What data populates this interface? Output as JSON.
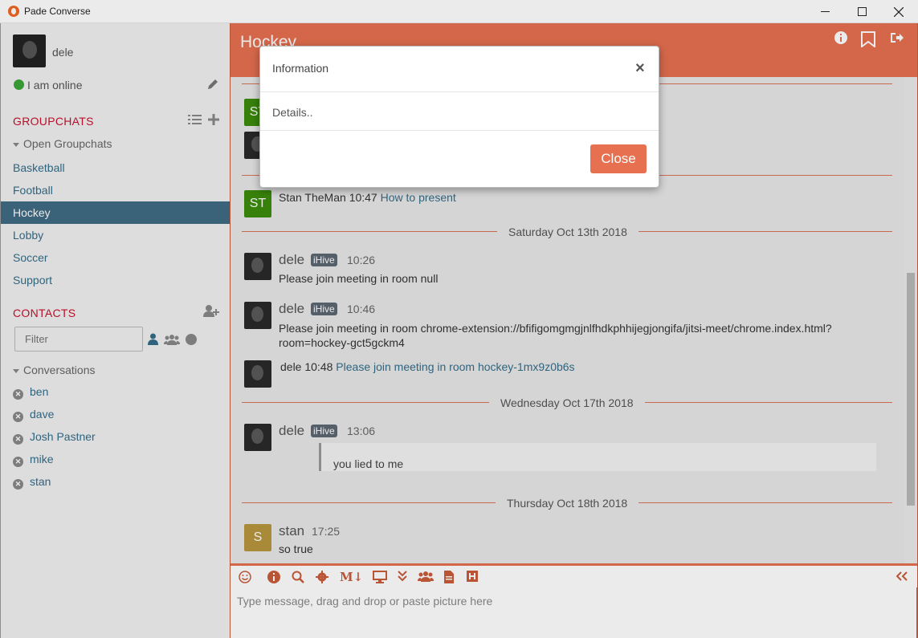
{
  "window": {
    "title": "Pade Converse"
  },
  "profile": {
    "name": "dele",
    "status": "I am online"
  },
  "groupchats": {
    "title": "GROUPCHATS",
    "tree_label": "Open Groupchats",
    "rooms": [
      "Basketball",
      "Football",
      "Hockey",
      "Lobby",
      "Soccer",
      "Support"
    ],
    "active": "Hockey"
  },
  "contacts": {
    "title": "CONTACTS",
    "filter_placeholder": "Filter",
    "tree_label": "Conversations",
    "items": [
      "ben",
      "dave",
      "Josh Pastner",
      "mike",
      "stan"
    ]
  },
  "chat": {
    "title": "Hockey",
    "messages": {
      "stan1": {
        "avatar": "ST",
        "sender": "Stan TheMan",
        "time": "10:47",
        "link": "How to present"
      },
      "date1": "Saturday Oct 13th 2018",
      "dele1": {
        "sender": "dele",
        "badge": "iHive",
        "time": "10:26",
        "text": "Please join meeting in room null"
      },
      "dele2": {
        "sender": "dele",
        "badge": "iHive",
        "time": "10:46",
        "text_line1": "Please join meeting in room chrome-extension://bfifigomgmgjnlfhdkphhijegjongifa/jitsi-meet/chrome.index.html?",
        "text_line2": "room=hockey-gct5gckm4"
      },
      "dele3": {
        "sender": "dele",
        "time": "10:48",
        "link": "Please join meeting in room hockey-1mx9z0b6s"
      },
      "date2": "Wednesday Oct 17th 2018",
      "dele4": {
        "sender": "dele",
        "badge": "iHive",
        "time": "13:06",
        "quote": "you lied to me"
      },
      "date3": "Thursday Oct 18th 2018",
      "stan2": {
        "avatar": "S",
        "sender": "stan",
        "time": "17:25",
        "text": "so true"
      },
      "partial_avatar": "ST"
    },
    "input_placeholder": "Type message, drag and drop or paste picture here",
    "toolbar": {
      "markdown": "M↓"
    }
  },
  "modal": {
    "title": "Information",
    "close_x": "×",
    "body": "Details..",
    "close_button": "Close"
  },
  "colors": {
    "accent": "#e77051",
    "active_room": "#3f6b84",
    "link": "#346d8a",
    "section_title": "#c8102e",
    "online": "#3aa537"
  }
}
